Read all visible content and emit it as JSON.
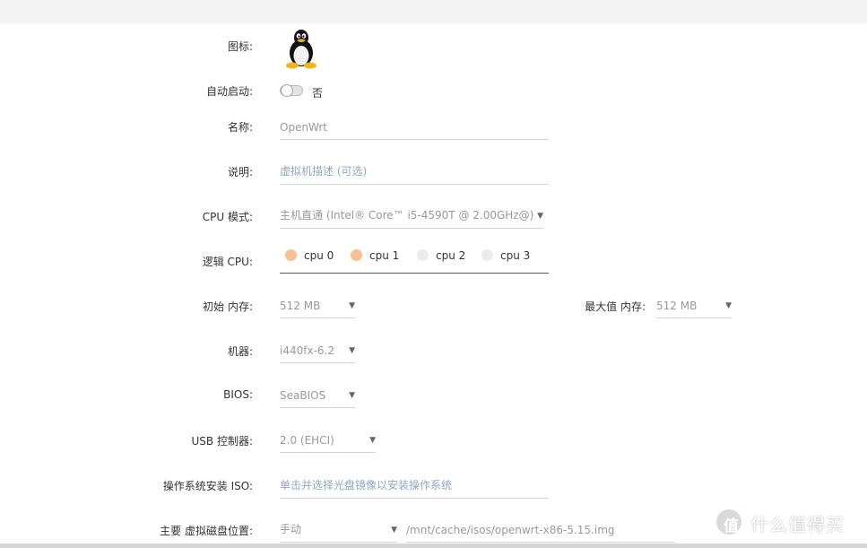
{
  "form": {
    "icon_label": "图标:",
    "autostart": {
      "label": "自动启动:",
      "value": "否",
      "enabled": false
    },
    "name": {
      "label": "名称:",
      "value": "OpenWrt"
    },
    "description": {
      "label": "说明:",
      "placeholder": "虚拟机描述 (可选)"
    },
    "cpu_mode": {
      "label": "CPU 模式:",
      "value": "主机直通 (Intel® Core™ i5-4590T @ 2.00GHz@)"
    },
    "logical_cpu": {
      "label": "逻辑 CPU:",
      "items": [
        {
          "label": "cpu 0",
          "selected": true
        },
        {
          "label": "cpu 1",
          "selected": true
        },
        {
          "label": "cpu 2",
          "selected": false
        },
        {
          "label": "cpu 3",
          "selected": false
        }
      ]
    },
    "initial_memory": {
      "label": "初始 内存:",
      "value": "512 MB"
    },
    "max_memory": {
      "label": "最大值 内存:",
      "value": "512 MB"
    },
    "machine": {
      "label": "机器:",
      "value": "i440fx-6.2"
    },
    "bios": {
      "label": "BIOS:",
      "value": "SeaBIOS"
    },
    "usb_controller": {
      "label": "USB 控制器:",
      "value": "2.0 (EHCI)"
    },
    "os_iso": {
      "label": "操作系统安装 ISO:",
      "placeholder": "单击并选择光盘镜像以安装操作系统"
    },
    "primary_disk": {
      "label": "主要 虚拟磁盘位置:",
      "mode": "手动",
      "path": "/mnt/cache/isos/openwrt-x86-5.15.img"
    }
  },
  "icons": {
    "os_icon": "linux-tux-icon",
    "dropdown": "caret-down-icon"
  },
  "colors": {
    "cpu_selected": "#f9c091",
    "cpu_unselected": "#ececec",
    "placeholder": "#8fa6c7"
  },
  "watermark": {
    "glyph": "值",
    "text": "什么值得买"
  }
}
